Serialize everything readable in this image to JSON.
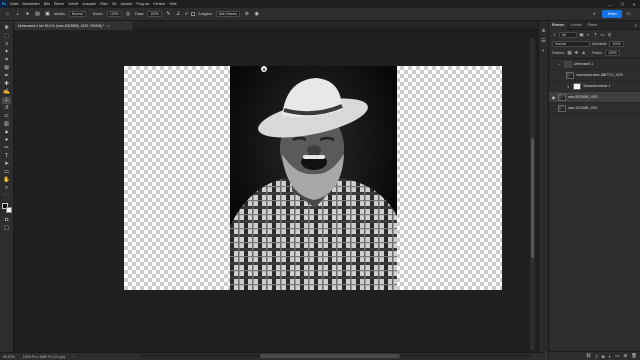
{
  "menubar": {
    "logo": "Ps",
    "items": [
      "Datei",
      "Bearbeiten",
      "Bild",
      "Ebene",
      "Schrift",
      "Auswahl",
      "Filter",
      "3D",
      "Ansicht",
      "Plug-ins",
      "Fenster",
      "Hilfe"
    ],
    "window_controls": [
      "—",
      "❐",
      "✕"
    ]
  },
  "options_bar": {
    "mode_label": "Modus:",
    "mode_value": "Normal",
    "opacity_label": "Deckr.:",
    "opacity_value": "100%",
    "flow_label": "Fluss:",
    "flow_value": "100%",
    "angle_value": "0°",
    "sample_label": "Ausgew.:",
    "sample_value": "Alle Ebenen",
    "share_label": "Teilen"
  },
  "document_tab": {
    "title": "Unbenannt-1 bei 59,1% (man-8325898_1920, RGB/8) *",
    "close": "×"
  },
  "status_bar": {
    "zoom": "59,07%",
    "doc_size": "1920 Px x 1080 Px (72 ppi)"
  },
  "layers_panel": {
    "tabs": [
      "Ebenen",
      "Kanäle",
      "Pfade"
    ],
    "filter_value": "Art",
    "blend_mode": "Normal",
    "opacity_label": "Deckkraft:",
    "opacity_value": "100%",
    "lock_label": "Fixieren:",
    "fill_label": "Fläche:",
    "fill_value": "100%",
    "layers": [
      {
        "name": "Unbenannt-1",
        "visible": false,
        "kind": "folder"
      },
      {
        "name": "man-beard-wise-3887712_1920",
        "visible": false,
        "kind": "photo"
      },
      {
        "name": "Tonwertkorrektur 1",
        "visible": false,
        "kind": "white"
      },
      {
        "name": "man-8325898_1920",
        "visible": true,
        "kind": "photo"
      },
      {
        "name": "man-1412068_1920",
        "visible": false,
        "kind": "photo"
      }
    ]
  }
}
